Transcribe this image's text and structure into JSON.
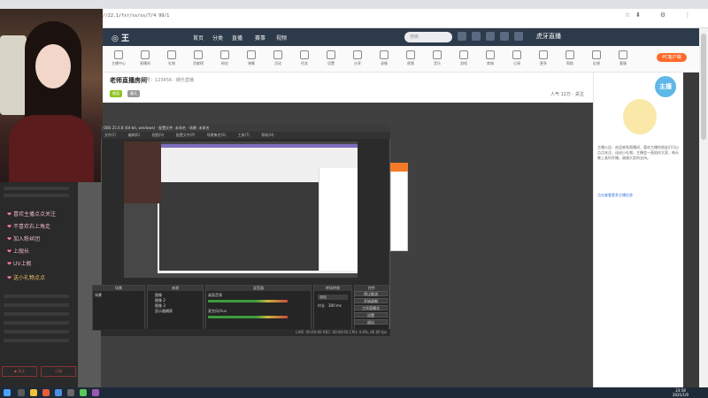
{
  "browser": {
    "url": "//22.1/fxr/ss/ss/7/4 99/1",
    "controls": [
      "☆",
      "⬇",
      "⚙",
      "⋮"
    ]
  },
  "site": {
    "logo": "◎ 王",
    "nav": [
      "首页",
      "分类",
      "直播",
      "赛事",
      "视频"
    ],
    "search_placeholder": "搜索",
    "brand": "虎牙直播"
  },
  "toolbar": {
    "items": [
      "主播中心",
      "直播间",
      "礼物",
      "贡献榜",
      "粉丝",
      "弹幕",
      "活动",
      "任务",
      "设置",
      "分享",
      "录像",
      "视频",
      "音乐",
      "游戏",
      "商城",
      "订阅",
      "更多",
      "帮助",
      "反馈",
      "客服"
    ],
    "pc_button": "PC客户端"
  },
  "stream": {
    "room_title": "老师直播房间",
    "room_sub": "房号：123456 · 娱乐直播",
    "tags": [
      "颜值",
      "聊天"
    ],
    "stats": "人气 12万 · 关注"
  },
  "right_panel": {
    "badge": "主播",
    "desc": "主播公告：欢迎来到直播间，喜欢主播的朋友们可以点点关注，送送小礼物，主播会一直陪伴大家，每天晚上准时开播，谢谢大家的支持。",
    "link": "点击查看更多主播信息"
  },
  "chat": {
    "lines": [
      "喜欢主播点点关注",
      "不喜欢右上角走",
      "加入粉丝团",
      "上舰长",
      "UV上舰",
      "送小礼物点点"
    ],
    "buttons": [
      "◆ 关注",
      "订阅"
    ]
  },
  "obs": {
    "title": "OBS 25.0.8 (64-bit, windows) - 配置文件: 未命名 - 场景: 未命名",
    "menu": [
      "文件(F)",
      "编辑(E)",
      "视图(V)",
      "配置文件(P)",
      "场景集合(S)",
      "工具(T)",
      "帮助(H)"
    ],
    "dock_scenes": "场景",
    "dock_sources": "来源",
    "dock_mixer": "混音器",
    "dock_transitions": "转场特效",
    "dock_controls": "控件",
    "scene_item": "场景",
    "sources": [
      "图像",
      "图像 2",
      "图像 3",
      "显示器捕获"
    ],
    "mixer_labels": [
      "桌面音频",
      "麦克风/Aux"
    ],
    "transition_value": "淡出",
    "duration_label": "时长",
    "duration_value": "300 ms",
    "controls": [
      "停止推流",
      "开始录制",
      "工作室模式",
      "设置",
      "退出"
    ],
    "status": "LIVE: 00:00:00   REC: 00:00:00   CPU: 4.9%, 60.00 fps"
  },
  "taskbar": {
    "time": "23:58",
    "date": "2021/1/9"
  }
}
